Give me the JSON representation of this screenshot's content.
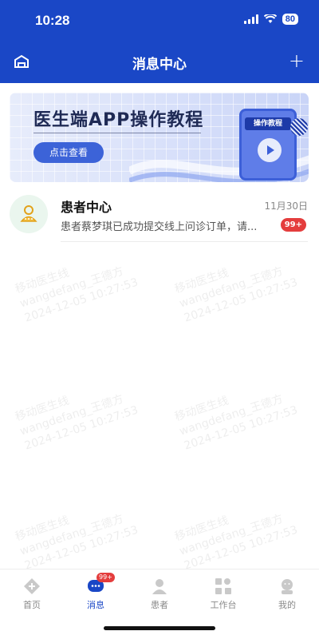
{
  "status_bar": {
    "time": "10:28",
    "battery": "80"
  },
  "header": {
    "title": "消息中心",
    "add_label": "+"
  },
  "banner": {
    "title": "医生端APP操作教程",
    "button": "点击查看",
    "phone_label": "操作教程"
  },
  "messages": [
    {
      "name": "患者中心",
      "date": "11月30日",
      "preview": "患者蔡梦琪已成功提交线上问诊订单，请...",
      "badge": "99+"
    }
  ],
  "watermark": {
    "line1": "移动医生线",
    "line2": "wangdefang_王德方",
    "line3": "2024-12-05 10:27:53"
  },
  "tabs": [
    {
      "label": "首页",
      "icon": "home-plus-icon"
    },
    {
      "label": "消息",
      "icon": "message-icon",
      "badge": "99+",
      "active": true
    },
    {
      "label": "患者",
      "icon": "patient-icon"
    },
    {
      "label": "工作台",
      "icon": "workbench-icon"
    },
    {
      "label": "我的",
      "icon": "profile-icon"
    }
  ],
  "colors": {
    "primary": "#1a47c6",
    "badge": "#e43d3d"
  }
}
